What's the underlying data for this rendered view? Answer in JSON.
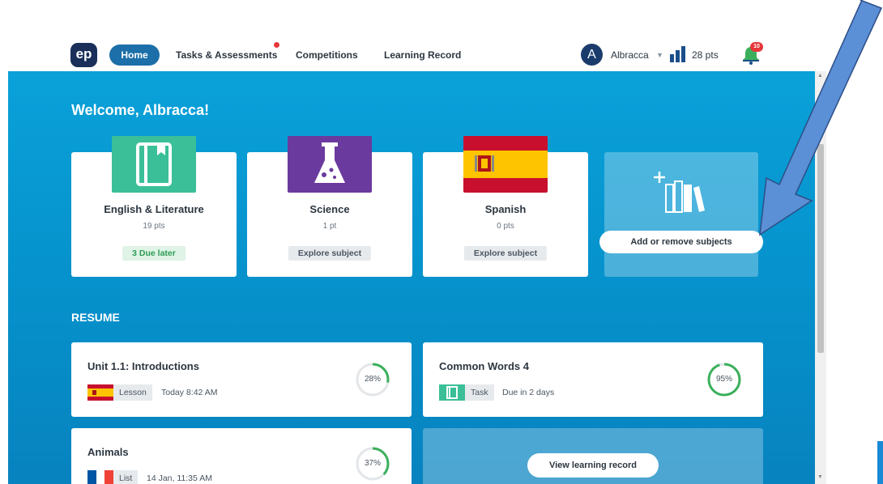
{
  "nav": {
    "logo": "ep",
    "home": "Home",
    "tasks": "Tasks & Assessments",
    "competitions": "Competitions",
    "learning_record": "Learning Record",
    "avatar_letter": "A",
    "user": "Albracca",
    "points": "28 pts",
    "notifications": "10"
  },
  "welcome": "Welcome, Albracca!",
  "subjects": [
    {
      "name": "English & Literature",
      "points": "19 pts",
      "action": "3 Due later",
      "icon": "book-icon",
      "color": "#3bbf98"
    },
    {
      "name": "Science",
      "points": "1 pt",
      "action": "Explore subject",
      "icon": "flask-icon",
      "color": "#6b3a9e"
    },
    {
      "name": "Spanish",
      "points": "0 pts",
      "action": "Explore subject",
      "icon": "spain-flag-icon",
      "color": "#c8102e"
    }
  ],
  "add_subjects": "Add or remove subjects",
  "resume": {
    "title": "RESUME",
    "items": [
      {
        "title": "Unit 1.1: Introductions",
        "type": "Lesson",
        "time": "Today 8:42 AM",
        "progress": "28%",
        "progress_value": 28,
        "icon": "spain-flag-icon"
      },
      {
        "title": "Common Words 4",
        "type": "Task",
        "time": "Due in 2 days",
        "progress": "95%",
        "progress_value": 95,
        "icon": "book-icon"
      },
      {
        "title": "Animals",
        "type": "List",
        "time": "14 Jan, 11:35 AM",
        "progress": "37%",
        "progress_value": 37,
        "icon": "france-flag-icon"
      }
    ],
    "view_record": "View learning record"
  },
  "colors": {
    "accent_blue": "#1c6fa8",
    "panel_blue": "#0aa1d9",
    "progress_green": "#3bb05c",
    "badge_red": "#e5373b",
    "arrow_blue": "#5b8fd6"
  }
}
